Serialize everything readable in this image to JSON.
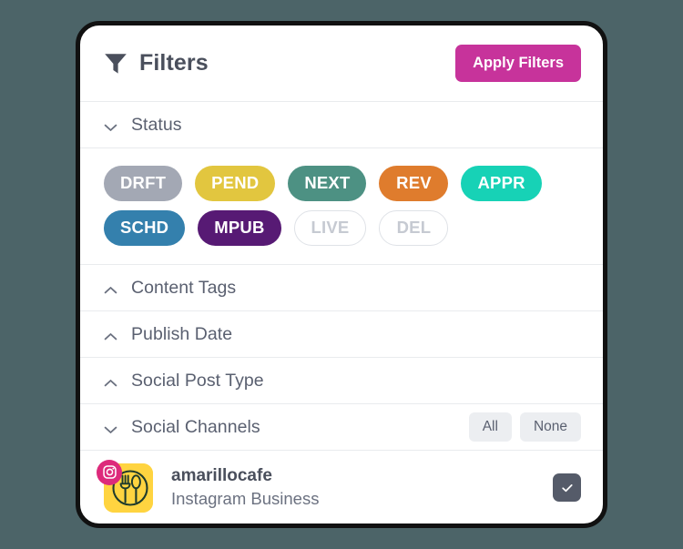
{
  "header": {
    "title": "Filters",
    "icon": "funnel-icon",
    "apply_label": "Apply Filters",
    "apply_color": "#c7339b"
  },
  "sections": {
    "status": {
      "label": "Status",
      "chevron": "chevron-down-icon",
      "expanded": true,
      "badges": [
        {
          "label": "DRFT",
          "color": "#a3a8b4",
          "selected": true
        },
        {
          "label": "PEND",
          "color": "#e2c63f",
          "selected": true
        },
        {
          "label": "NEXT",
          "color": "#4d9183",
          "selected": true
        },
        {
          "label": "REV",
          "color": "#df7c2d",
          "selected": true
        },
        {
          "label": "APPR",
          "color": "#17d2b6",
          "selected": true
        },
        {
          "label": "SCHD",
          "color": "#3480ad",
          "selected": true
        },
        {
          "label": "MPUB",
          "color": "#571a74",
          "selected": true
        },
        {
          "label": "LIVE",
          "color": "#ffffff",
          "selected": false
        },
        {
          "label": "DEL",
          "color": "#ffffff",
          "selected": false
        }
      ]
    },
    "content_tags": {
      "label": "Content Tags",
      "chevron": "chevron-up-icon",
      "expanded": false
    },
    "publish_date": {
      "label": "Publish Date",
      "chevron": "chevron-up-icon",
      "expanded": false
    },
    "social_post_type": {
      "label": "Social Post Type",
      "chevron": "chevron-up-icon",
      "expanded": false
    },
    "social_channels": {
      "label": "Social Channels",
      "chevron": "chevron-down-icon",
      "expanded": true,
      "all_label": "All",
      "none_label": "None",
      "accounts": [
        {
          "name": "amarillocafe",
          "type": "Instagram Business",
          "network_icon": "instagram-icon",
          "network_color": "#dd2a7b",
          "avatar_color": "#ffd440",
          "avatar_icon": "restaurant-plate-icon",
          "checked": true
        }
      ]
    }
  }
}
